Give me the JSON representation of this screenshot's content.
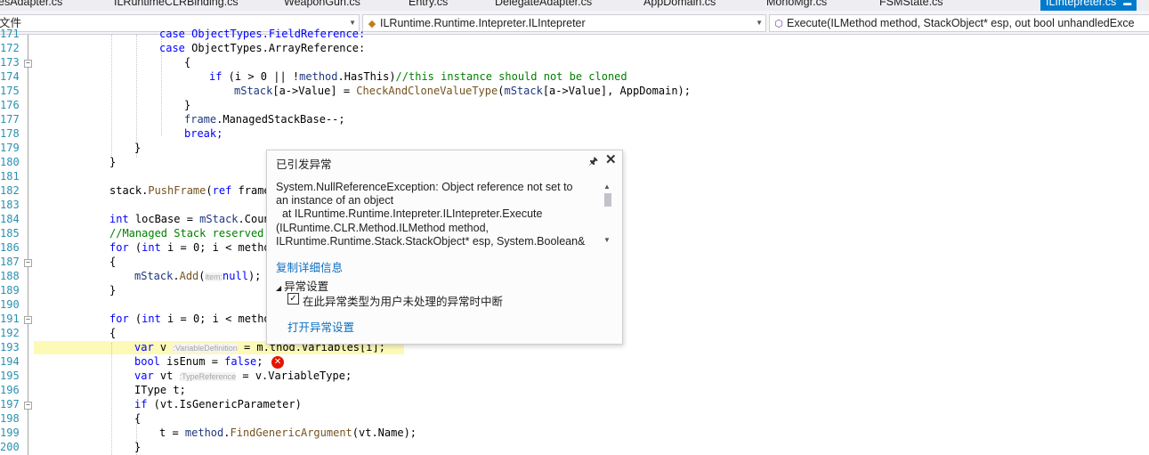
{
  "tabs": [
    {
      "label": "esAdapter.cs",
      "active": false
    },
    {
      "label": "ILRuntimeCLRBinding.cs",
      "active": false
    },
    {
      "label": "WeaponGun.cs",
      "active": false
    },
    {
      "label": "Entry.cs",
      "active": false
    },
    {
      "label": "DelegateAdapter.cs",
      "active": false
    },
    {
      "label": "AppDomain.cs",
      "active": false
    },
    {
      "label": "MonoMgr.cs",
      "active": false
    },
    {
      "label": "FSMState.cs",
      "active": false
    },
    {
      "label": "ILIntepreter.cs",
      "active": true
    }
  ],
  "navbar": {
    "project": "文件",
    "type": "ILRuntime.Runtime.Intepreter.ILIntepreter",
    "member": "Execute(ILMethod method, StackObject* esp, out bool unhandledExce"
  },
  "line_numbers": [
    "171",
    "172",
    "173",
    "174",
    "175",
    "176",
    "177",
    "178",
    "179",
    "180",
    "181",
    "182",
    "183",
    "184",
    "185",
    "186",
    "187",
    "188",
    "189",
    "190",
    "191",
    "192",
    "193",
    "194",
    "195",
    "196",
    "197",
    "198",
    "199",
    "200"
  ],
  "code": {
    "l171": "case ObjectTypes.FieldReference:",
    "l172_kw": "case",
    "l172": " ObjectTypes.ArrayReference:",
    "l173": "{",
    "l174_if": "if",
    "l174_a": " (i > 0 || !",
    "l174_m": "method",
    "l174_b": ".HasThis)",
    "l174_c": "//this instance should not be cloned",
    "l175_a": "mStack",
    "l175_b": "[a->Value] = ",
    "l175_fn": "CheckAndCloneValueType",
    "l175_c": "(",
    "l175_d": "mStack",
    "l175_e": "[a->Value], AppDomain);",
    "l176": "}",
    "l177_a": "frame",
    "l177_b": ".ManagedStackBase--;",
    "l178": "break;",
    "l179": "}",
    "l180": "}",
    "l182_a": "stack.",
    "l182_fn": "PushFrame",
    "l182_b": "(",
    "l182_kw": "ref",
    "l182_c": " frame",
    "l184_kw": "int",
    "l184_a": " locBase = ",
    "l184_b": "mStack",
    "l184_c": ".Coun",
    "l185": "//Managed Stack reserved",
    "l186_for": "for",
    "l186_a": " (",
    "l186_int": "int",
    "l186_b": " i = 0; i < metho",
    "l187": "{",
    "l188_a": "mStack",
    "l188_b": ".",
    "l188_fn": "Add",
    "l188_c": "(",
    "l188_hint": "item:",
    "l188_null": "null",
    "l188_d": ");",
    "l189": "}",
    "l191_for": "for",
    "l191_a": " (",
    "l191_int": "int",
    "l191_b": " i = 0; i < metho",
    "l192": "{",
    "l193_var": "var",
    "l193_a": " v ",
    "l193_hint": ":VariableDefinition",
    "l193_b": " = m",
    "l193_c": ".thod.Variables[i];",
    "l194_kw": "bool",
    "l194_a": " isEnum = ",
    "l194_false": "false",
    "l194_b": ";",
    "l195_var": "var",
    "l195_a": " vt ",
    "l195_hint": ":TypeReference",
    "l195_b": " = v.VariableType;",
    "l196_ty": "IType",
    "l196_a": " t;",
    "l197_if": "if",
    "l197_a": " (vt.IsGenericParameter)",
    "l198": "{",
    "l199_a": "t = ",
    "l199_m": "method",
    "l199_b": ".",
    "l199_fn": "FindGenericArgument",
    "l199_c": "(vt.Name);",
    "l200": "}"
  },
  "exception_popup": {
    "title": "已引发异常",
    "message": "System.NullReferenceException: Object reference not set to\nan instance of an object\n  at ILRuntime.Runtime.Intepreter.ILIntepreter.Execute\n(ILRuntime.CLR.Method.ILMethod method,\nILRuntime.Runtime.Stack.StackObject* esp, System.Boolean&",
    "copy_details": "复制详细信息",
    "section": "异常设置",
    "checkbox_label": "在此异常类型为用户未处理的异常时中断",
    "checkbox_checked": true,
    "open_settings": "打开异常设置"
  },
  "colors": {
    "accent": "#007acc",
    "keyword": "#0000ff",
    "comment": "#008000",
    "line_number": "#2b91af",
    "current_line": "#fdf9b7",
    "error": "#e51400",
    "link": "#0e70c0"
  }
}
